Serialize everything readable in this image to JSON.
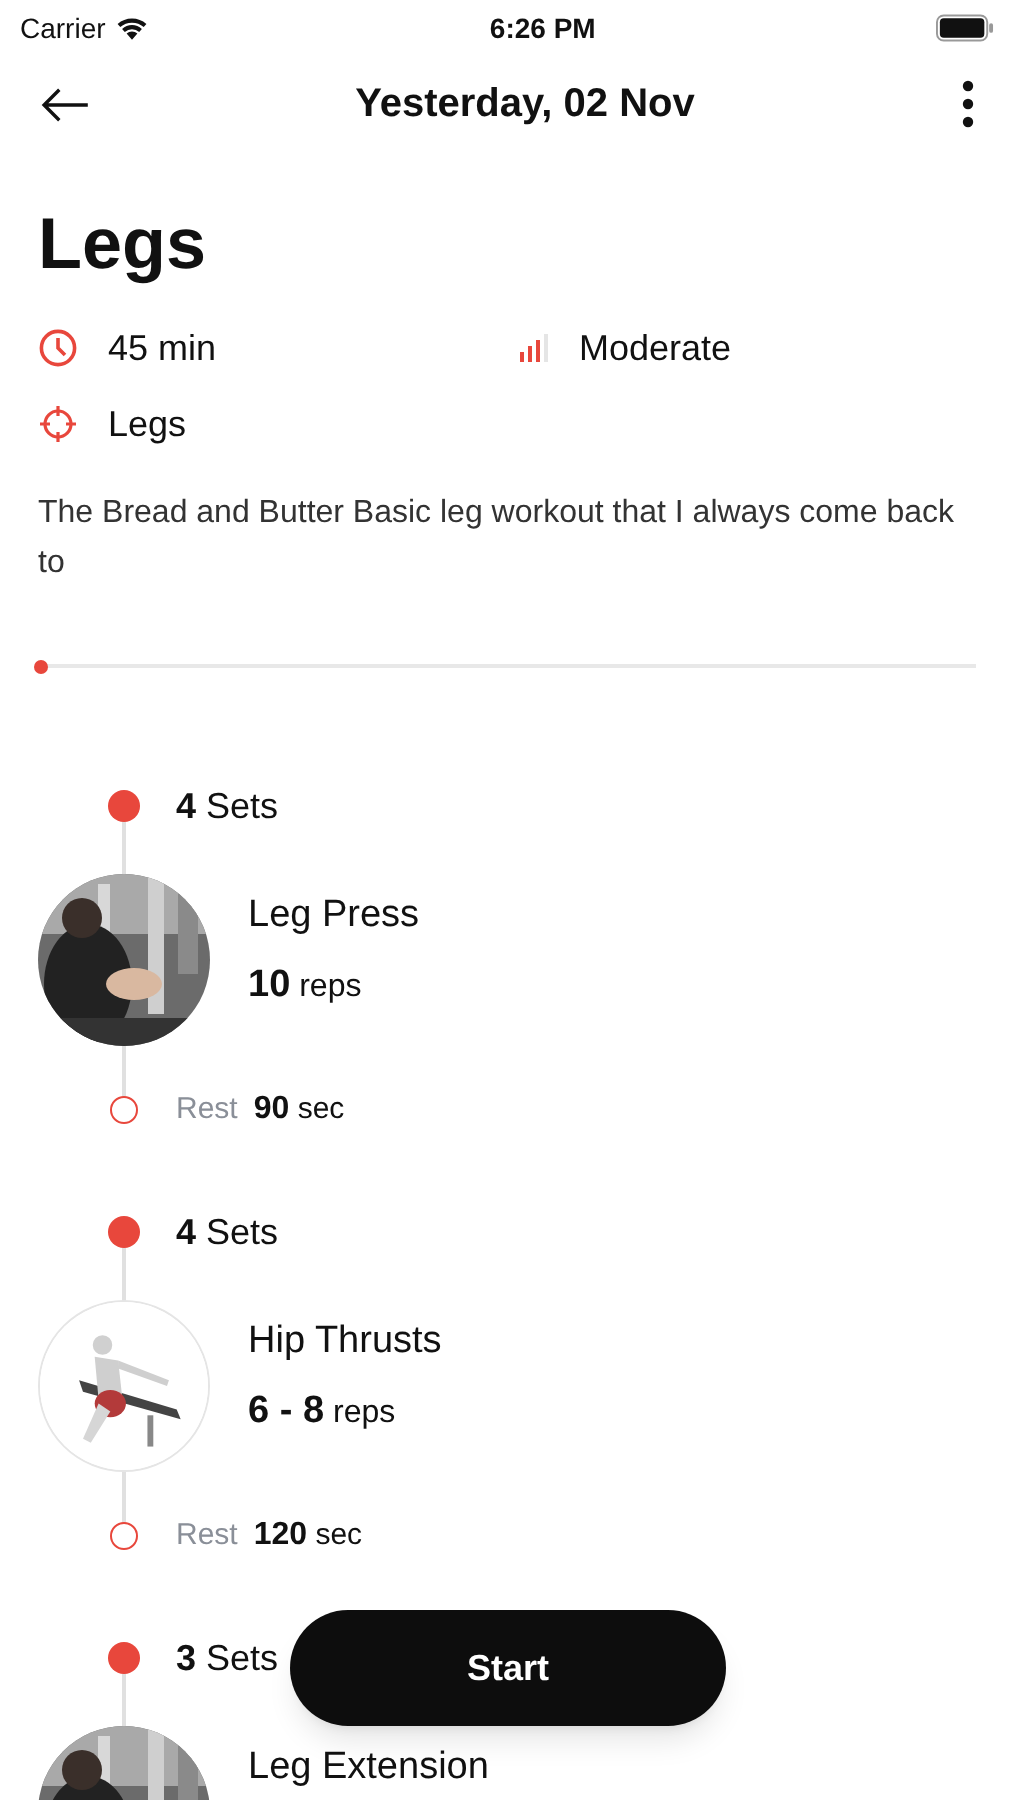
{
  "status_bar": {
    "carrier": "Carrier",
    "time": "6:26 PM"
  },
  "header": {
    "title": "Yesterday, 02 Nov"
  },
  "workout": {
    "title": "Legs",
    "duration": "45 min",
    "difficulty": "Moderate",
    "target": "Legs",
    "description": "The Bread and Butter Basic leg workout that I always come back to"
  },
  "progress": {
    "level": 0
  },
  "exercises": [
    {
      "sets_count": "4",
      "sets_label": "Sets",
      "name": "Leg Press",
      "reps_value": "10",
      "reps_unit": "reps",
      "rest_label": "Rest",
      "rest_value": "90",
      "rest_unit": "sec"
    },
    {
      "sets_count": "4",
      "sets_label": "Sets",
      "name": "Hip Thrusts",
      "reps_value": "6 - 8",
      "reps_unit": "reps",
      "rest_label": "Rest",
      "rest_value": "120",
      "rest_unit": "sec"
    },
    {
      "sets_count": "3",
      "sets_label": "Sets",
      "name": "Leg Extension"
    }
  ],
  "start_button": {
    "label": "Start"
  }
}
